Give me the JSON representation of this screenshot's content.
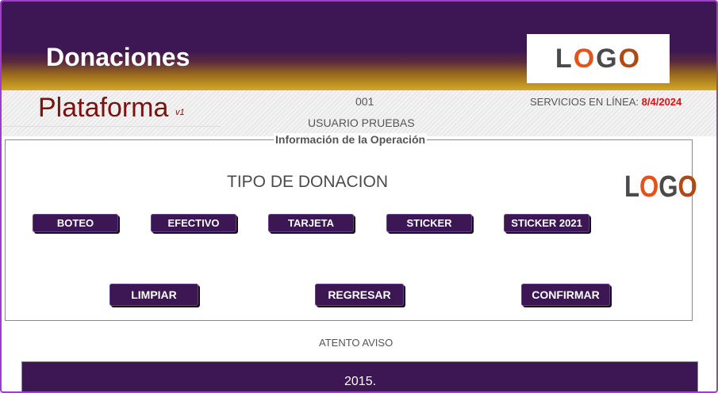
{
  "header": {
    "title": "Donaciones",
    "logo_text": "LOGO"
  },
  "infobar": {
    "platform": "Plataforma",
    "version": "v1",
    "code": "001",
    "user": "USUARIO PRUEBAS",
    "services_label": "SERVICIOS EN LÍNEA:",
    "services_date": "8/4/2024"
  },
  "panel": {
    "legend": "Información de la Operación",
    "heading": "TIPO DE DONACION",
    "logo_text": "LOGO",
    "donation_types": [
      "BOTEO",
      "EFECTIVO",
      "TARJETA",
      "STICKER",
      "STICKER 2021"
    ],
    "actions": {
      "clear": "LIMPIAR",
      "back": "REGRESAR",
      "confirm": "CONFIRMAR"
    }
  },
  "notice": "ATENTO AVISO",
  "footer": {
    "text": "2015."
  },
  "colors": {
    "brand_purple": "#3d1654",
    "accent_gold": "#d4a82a",
    "platform_red": "#7a1212",
    "date_red": "#e01010",
    "logo_orange": "#e2541c"
  }
}
